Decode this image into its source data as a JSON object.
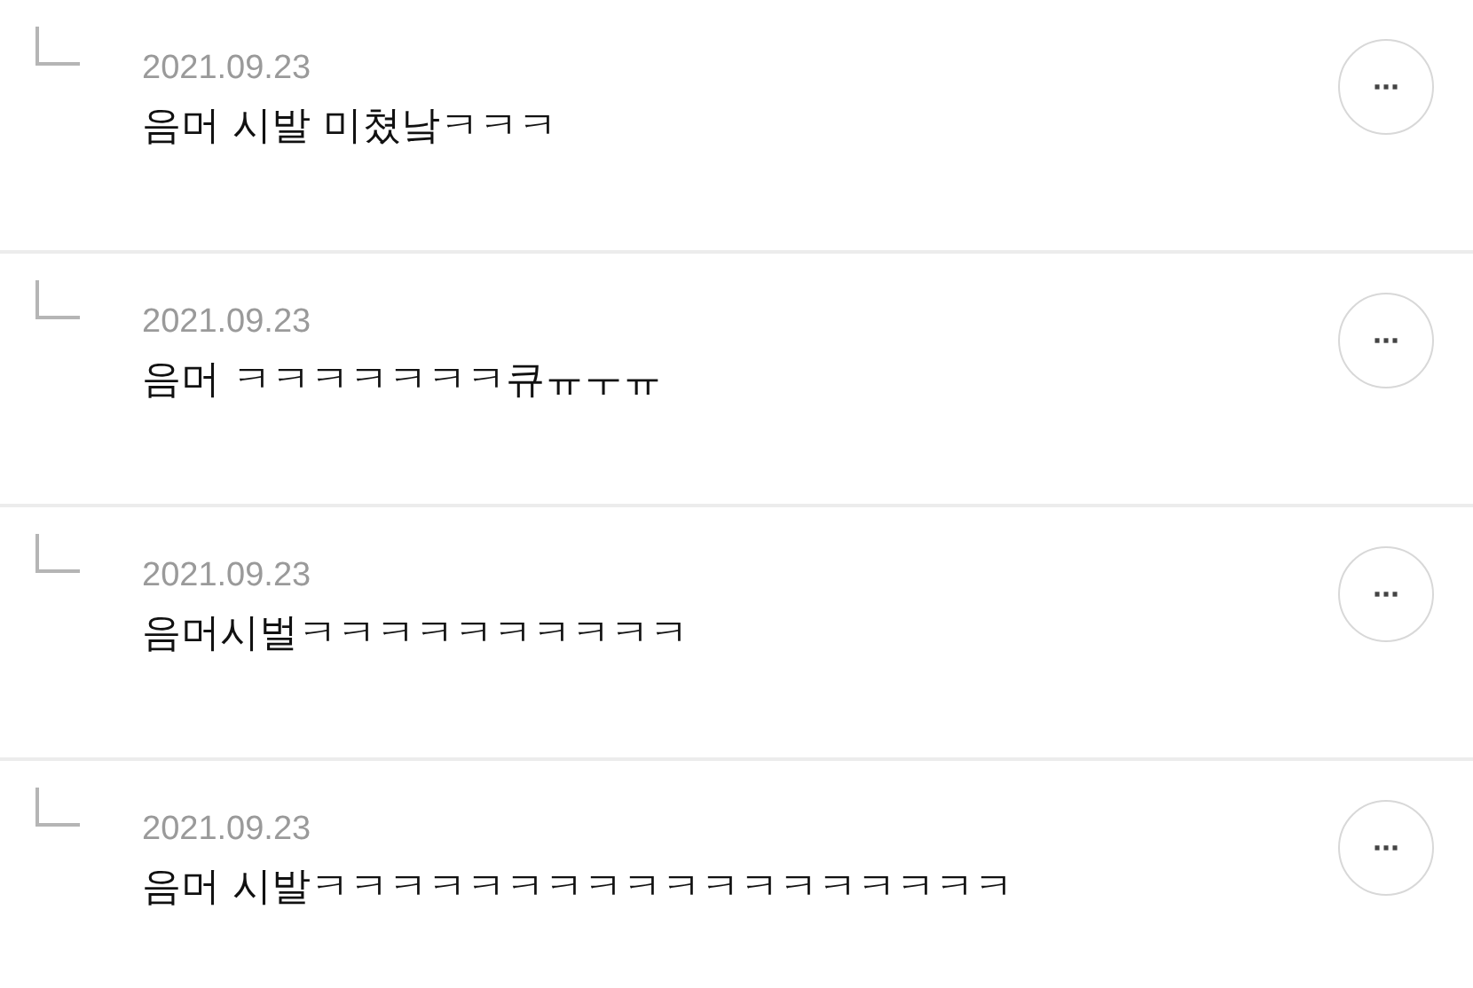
{
  "replies": [
    {
      "date": "2021.09.23",
      "text": "음머 시발 미쳤낰ㅋㅋㅋ",
      "more": "···"
    },
    {
      "date": "2021.09.23",
      "text": "음머 ㅋㅋㅋㅋㅋㅋㅋ큐ㅠㅜㅠ",
      "more": "···"
    },
    {
      "date": "2021.09.23",
      "text": "음머시벌ㅋㅋㅋㅋㅋㅋㅋㅋㅋㅋ",
      "more": "···"
    },
    {
      "date": "2021.09.23",
      "text": "음머 시발ㅋㅋㅋㅋㅋㅋㅋㅋㅋㅋㅋㅋㅋㅋㅋㅋㅋㅋ",
      "more": "···"
    }
  ]
}
